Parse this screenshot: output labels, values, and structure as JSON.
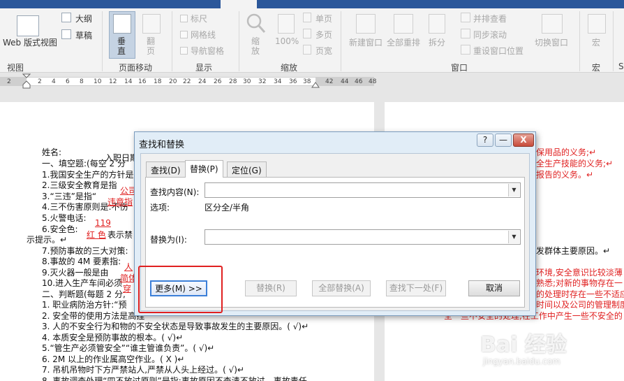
{
  "ribbon": {
    "groups": {
      "view": {
        "label": "视图",
        "web_layout": "Web 版式视图",
        "outline": "大纲",
        "draft": "草稿"
      },
      "page_movement": {
        "label": "页面移动",
        "vertical": "垂直",
        "side_to_side": "翻页"
      },
      "show": {
        "label": "显示",
        "ruler": "标尺",
        "gridlines": "网格线",
        "nav_pane": "导航窗格"
      },
      "zoom": {
        "label": "缩放",
        "zoom": "缩放",
        "hundred": "100%",
        "one_page": "单页",
        "multi_page": "多页",
        "page_width": "页宽"
      },
      "window": {
        "label": "窗口",
        "new_window": "新建窗口",
        "arrange_all": "全部重排",
        "split": "拆分",
        "side_by_side": "并排查看",
        "sync_scroll": "同步滚动",
        "reset_pos": "重设窗口位置",
        "switch_windows": "切换窗口"
      },
      "macros": {
        "label": "宏",
        "macro": "宏",
        "more": "S"
      }
    }
  },
  "ruler": {
    "ticks": [
      "2",
      "2",
      "4",
      "6",
      "8",
      "10",
      "12",
      "14",
      "16",
      "18",
      "20",
      "22",
      "24",
      "26",
      "28",
      "30",
      "32",
      "34",
      "36",
      "38",
      "42",
      "44",
      "46",
      "48"
    ]
  },
  "document": {
    "left": [
      {
        "text": "姓名:",
        "red": false
      },
      {
        "text": "一、填空题:(每空 2 分",
        "red": false
      },
      {
        "text": "1.我国安全生产的方针是",
        "red": false
      },
      {
        "text": "2.三级安全教育是指",
        "red": false
      },
      {
        "text": "3.“三违”是指“",
        "red": false
      },
      {
        "text": "4.三不伤害原则是:不伤",
        "red": false
      },
      {
        "text": "5.火警电话:",
        "red": false
      },
      {
        "text": "6.安全色:",
        "red": false
      },
      {
        "text": "示提示。↵",
        "red": false
      },
      {
        "text": "7.预防事故的三大对策:",
        "red": false
      },
      {
        "text": "8.事故的 4M 要素指:",
        "red": false
      },
      {
        "text": "9.灭火器一般是由",
        "red": false
      },
      {
        "text": "10.进入生产车间必须",
        "red": false
      },
      {
        "text": "二、判断题(每题 2 分,",
        "red": false
      },
      {
        "text": "1. 职业病防治方针:“预",
        "red": false
      },
      {
        "text": "2. 安全带的使用方法是高挂",
        "red": false
      },
      {
        "text": "3. 人的不安全行为和物的不安全状态是导致事故发生的主要原因。( √)↵",
        "red": false
      },
      {
        "text": "4. 本质安全是预防事故的根本。( √)↵",
        "red": false
      },
      {
        "text": "5.“管生产必须管安全”“谁主管谁负责”。( √)↵",
        "red": false
      },
      {
        "text": "6. 2M 以上的作业属高空作业。( X )↵",
        "red": false
      },
      {
        "text": "7. 吊机吊物时下方严禁站人,严禁从人头上经过。( √)↵",
        "red": false
      },
      {
        "text": "8. 事故调查处理“四不放过原则”是指:事故原因不查清不放过、事故责任",
        "red": false
      }
    ],
    "left_inline": {
      "name_tail": "入职日期",
      "level3": "公司",
      "three_violations": "违章指",
      "fire_number": "119",
      "color_red": "红 色",
      "color_tail": "表示禁",
      "fourm": "人",
      "extinguisher": "简体",
      "workshop": "穿"
    },
    "right": [
      {
        "text": "保用品的义务;↵",
        "red": true
      },
      {
        "text": "全生产技能的义务;↵",
        "red": true
      },
      {
        "text": "报告的义务。↵",
        "red": true
      },
      {
        "text": "发群体主要原因。↵",
        "red": false
      },
      {
        "text": "环境,安全意识比较淡薄",
        "red": true
      },
      {
        "text": "熟悉;对新的事物存在一",
        "red": true
      },
      {
        "text": "的处理时存在一些不适应",
        "red": true
      },
      {
        "text": "时间以及公司的管理制度",
        "red": true
      },
      {
        "text": "全一些不安全的处理,在工作中产生一些不安全的",
        "red": true
      }
    ]
  },
  "dialog": {
    "title": "查找和替换",
    "help_label": "?",
    "minimize_label": "—",
    "close_label": "X",
    "tabs": [
      "查找(D)",
      "替换(P)",
      "定位(G)"
    ],
    "find_label": "查找内容(N):",
    "find_value": "",
    "options_label": "选项:",
    "options_value": "区分全/半角",
    "replace_label": "替换为(I):",
    "replace_value": "",
    "buttons": {
      "more": "更多(M) >>",
      "replace": "替换(R)",
      "replace_all": "全部替换(A)",
      "find_next": "查找下一处(F)",
      "cancel": "取消"
    }
  },
  "watermark": {
    "text": "Bai 经验",
    "url": "jingyan.baidu.com"
  },
  "colors": {
    "accent": "#2b579a",
    "red_text": "#e02020",
    "dialog_bg": "#e1edf7"
  }
}
